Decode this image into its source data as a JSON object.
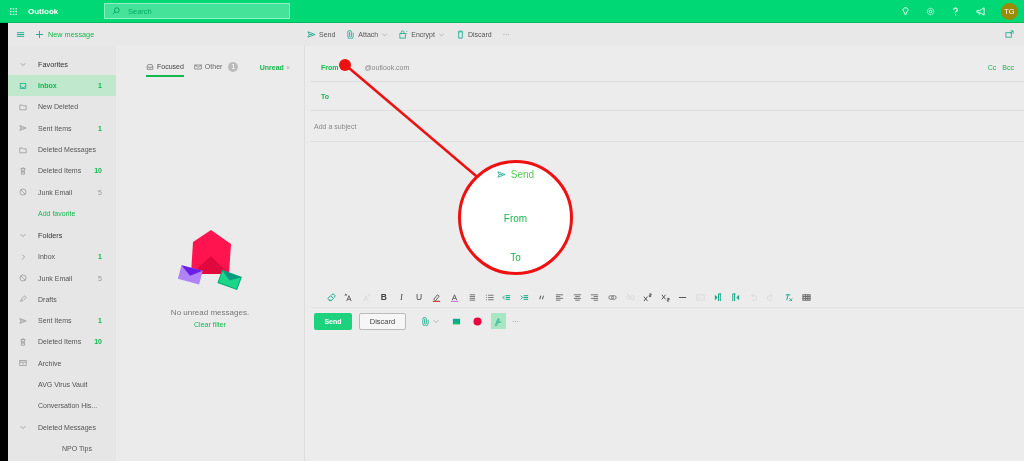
{
  "header": {
    "app_name": "Outlook",
    "search": {
      "placeholder": "Search"
    },
    "avatar": "TG"
  },
  "command_bar": {
    "new_message": "New message",
    "actions": [
      {
        "kind": "send",
        "label": "Send",
        "dropdown": false
      },
      {
        "kind": "attach",
        "label": "Attach",
        "dropdown": true
      },
      {
        "kind": "encrypt",
        "label": "Encrypt",
        "dropdown": true
      },
      {
        "kind": "discard",
        "label": "Discard",
        "dropdown": false
      }
    ],
    "more": "···"
  },
  "sidebar": {
    "sections": [
      {
        "title": "Favorites",
        "expanded": true,
        "link": "Add favorite",
        "items": [
          {
            "kind": "inbox",
            "name": "Inbox",
            "count": "1",
            "unread": true,
            "selected": true
          },
          {
            "kind": "folder",
            "name": "New Deleted",
            "selected": false
          },
          {
            "kind": "sent",
            "name": "Sent Items",
            "count": "1",
            "unread": true,
            "selected": false
          },
          {
            "kind": "folder",
            "name": "Deleted Messages",
            "selected": false
          },
          {
            "kind": "trash",
            "name": "Deleted Items",
            "count": "10",
            "unread": true,
            "selected": false
          },
          {
            "kind": "junk",
            "name": "Junk Email",
            "count": "5",
            "unread": false,
            "selected": false
          }
        ]
      },
      {
        "title": "Folders",
        "expanded": true,
        "items": [
          {
            "name": "Inbox",
            "count": "1",
            "unread": true,
            "selected": false,
            "expanded": false
          },
          {
            "kind": "junk",
            "name": "Junk Email",
            "count": "5",
            "unread": false,
            "selected": false
          },
          {
            "kind": "drafts",
            "name": "Drafts",
            "selected": false
          },
          {
            "kind": "sent",
            "name": "Sent Items",
            "count": "1",
            "unread": true,
            "selected": false
          },
          {
            "kind": "trash",
            "name": "Deleted Items",
            "count": "10",
            "unread": true,
            "selected": false
          },
          {
            "kind": "archive",
            "name": "Archive",
            "selected": false
          },
          {
            "name": "AVG Virus Vault",
            "selected": false
          },
          {
            "name": "Conversation His...",
            "selected": false
          },
          {
            "name": "Deleted Messages",
            "selected": false,
            "expanded": true,
            "children": [
              {
                "name": "NPO Tips",
                "selected": false
              }
            ]
          }
        ]
      }
    ]
  },
  "message_list": {
    "tabs": [
      {
        "label": "Focused",
        "selected": true
      },
      {
        "label": "Other",
        "badge": "1",
        "selected": false
      }
    ],
    "filter": {
      "label": "Unread",
      "clear": "×"
    },
    "empty_text": "No unread messages.",
    "clear_filter": "Clear filter"
  },
  "compose": {
    "from_label": "From",
    "from_value": "@outlook.com",
    "cc": "Cc",
    "bcc": "Bcc",
    "to_label": "To",
    "subject": {
      "placeholder": "Add a subject"
    },
    "format_toolbar": [
      {
        "kind": "format-painter",
        "disabled": false
      },
      {
        "kind": "font-size",
        "disabled": false
      },
      {
        "kind": "grow-font",
        "disabled": true
      },
      {
        "kind": "bold",
        "label": "B",
        "disabled": false
      },
      {
        "kind": "italic",
        "label": "I",
        "disabled": false
      },
      {
        "kind": "underline",
        "label": "U",
        "disabled": false
      },
      {
        "kind": "highlight",
        "disabled": false
      },
      {
        "kind": "font-color",
        "disabled": false
      },
      {
        "kind": "bullets",
        "disabled": false
      },
      {
        "kind": "numbering",
        "disabled": false
      },
      {
        "kind": "outdent",
        "disabled": false
      },
      {
        "kind": "indent",
        "disabled": false
      },
      {
        "kind": "quote",
        "disabled": false
      },
      {
        "kind": "align-left",
        "disabled": false
      },
      {
        "kind": "align-center",
        "disabled": false
      },
      {
        "kind": "align-right",
        "disabled": false
      },
      {
        "kind": "link",
        "disabled": false
      },
      {
        "kind": "unlink",
        "disabled": true
      },
      {
        "kind": "superscript",
        "disabled": false
      },
      {
        "kind": "subscript",
        "disabled": false
      },
      {
        "kind": "strikethrough",
        "disabled": false
      },
      {
        "kind": "image",
        "disabled": true
      },
      {
        "kind": "ltr",
        "disabled": false
      },
      {
        "kind": "rtl",
        "disabled": false
      },
      {
        "kind": "undo",
        "disabled": true
      },
      {
        "kind": "redo",
        "disabled": true
      },
      {
        "kind": "clear-format",
        "disabled": false
      },
      {
        "kind": "table",
        "disabled": false
      }
    ],
    "send": "Send",
    "discard": "Discard",
    "bottom_tools": [
      {
        "kind": "attach",
        "dropdown": true,
        "active": false
      },
      {
        "kind": "picture",
        "dropdown": false,
        "active": false
      },
      {
        "kind": "record",
        "dropdown": false,
        "active": false
      },
      {
        "kind": "signature",
        "dropdown": false,
        "active": true
      }
    ],
    "more": "···"
  },
  "callout": {
    "send": "Send",
    "from": "From",
    "to": "To"
  }
}
